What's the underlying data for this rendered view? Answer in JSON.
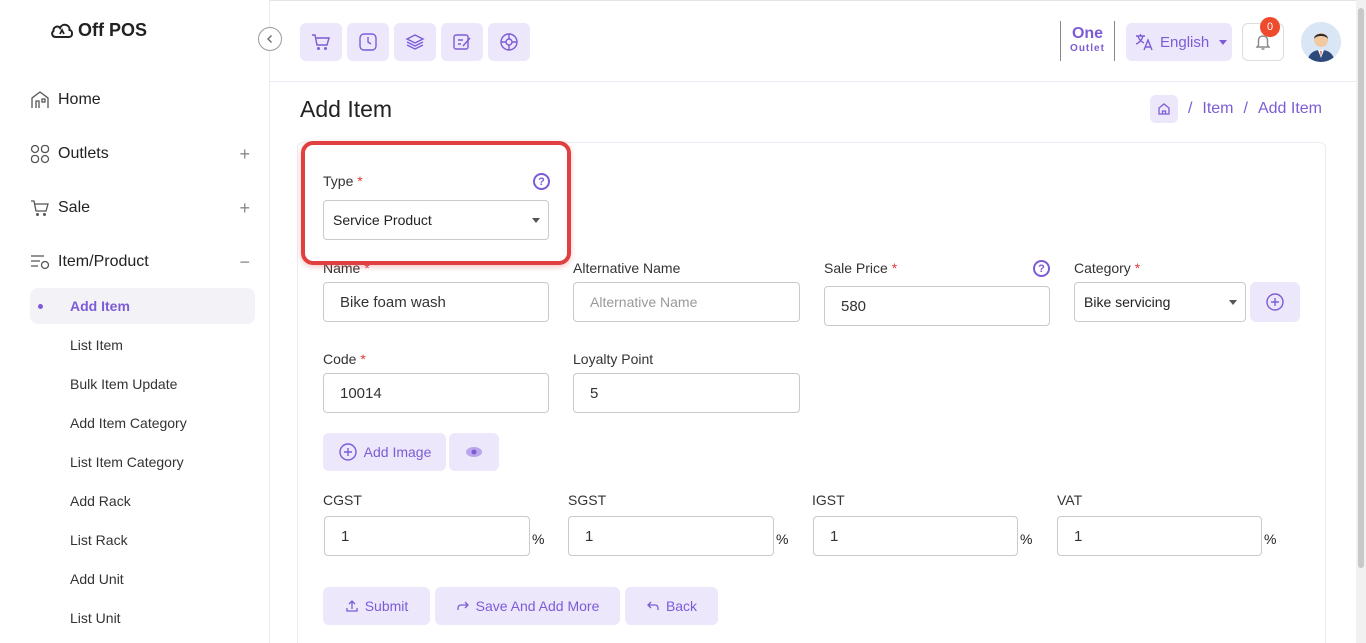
{
  "brand": {
    "name": "Off POS"
  },
  "sidebar": {
    "items": [
      {
        "label": "Home",
        "icon": "home-icon"
      },
      {
        "label": "Outlets",
        "icon": "grid-icon",
        "expand": "+"
      },
      {
        "label": "Sale",
        "icon": "cart-icon",
        "expand": "+"
      },
      {
        "label": "Item/Product",
        "icon": "list-icon",
        "expand": "−"
      }
    ],
    "subitems": [
      {
        "label": "Add Item",
        "active": true
      },
      {
        "label": "List Item"
      },
      {
        "label": "Bulk Item Update"
      },
      {
        "label": "Add Item Category"
      },
      {
        "label": "List Item Category"
      },
      {
        "label": "Add Rack"
      },
      {
        "label": "List Rack"
      },
      {
        "label": "Add Unit"
      },
      {
        "label": "List Unit"
      }
    ]
  },
  "topbar": {
    "quick_icons": [
      "cart-icon",
      "clock-icon",
      "layers-icon",
      "edit-icon",
      "aperture-icon"
    ],
    "outlet": {
      "line1": "One",
      "line2": "Outlet"
    },
    "language": "English",
    "notifications": "0"
  },
  "page": {
    "title": "Add Item",
    "breadcrumb": [
      "Item",
      "Add Item"
    ]
  },
  "form": {
    "type": {
      "label": "Type",
      "value": "Service Product"
    },
    "name": {
      "label": "Name",
      "value": "Bike foam wash"
    },
    "alt_name": {
      "label": "Alternative Name",
      "placeholder": "Alternative Name"
    },
    "sale_price": {
      "label": "Sale Price",
      "value": "580"
    },
    "category": {
      "label": "Category",
      "value": "Bike servicing"
    },
    "code": {
      "label": "Code",
      "value": "10014"
    },
    "loyalty": {
      "label": "Loyalty Point",
      "value": "5"
    },
    "add_image": "Add Image",
    "taxes": [
      {
        "label": "CGST",
        "value": "1",
        "unit": "%"
      },
      {
        "label": "SGST",
        "value": "1",
        "unit": "%"
      },
      {
        "label": "IGST",
        "value": "1",
        "unit": "%"
      },
      {
        "label": "VAT",
        "value": "1",
        "unit": "%"
      }
    ],
    "actions": {
      "submit": "Submit",
      "save_more": "Save And Add More",
      "back": "Back"
    }
  },
  "colors": {
    "accent": "#7c5cd6",
    "accent_light": "#ece7fb",
    "required": "#e53935",
    "highlight": "#e04040"
  }
}
